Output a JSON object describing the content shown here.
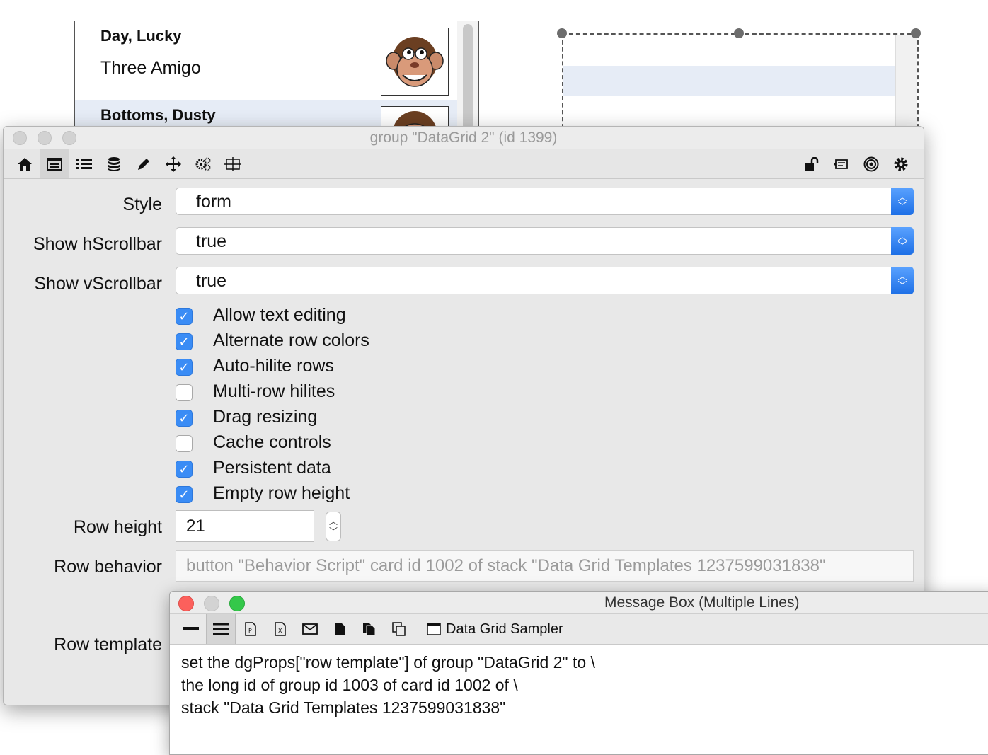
{
  "background_grid": {
    "rows": [
      {
        "name": "Day, Lucky",
        "title": "Three Amigo"
      },
      {
        "name": "Bottoms, Dusty"
      }
    ]
  },
  "inspector": {
    "window_title": "group \"DataGrid 2\" (id 1399)",
    "toolbar_left": [
      "home-icon",
      "table-icon",
      "list-icon",
      "database-icon",
      "pencil-icon",
      "move-icon",
      "gears-icon",
      "resize-icon"
    ],
    "toolbar_right": [
      "lock-icon",
      "message-icon",
      "target-icon",
      "gear-icon"
    ],
    "style": {
      "label": "Style",
      "value": "form"
    },
    "hscroll": {
      "label": "Show hScrollbar",
      "value": "true"
    },
    "vscroll": {
      "label": "Show vScrollbar",
      "value": "true"
    },
    "checkboxes": [
      {
        "label": "Allow text editing",
        "checked": true
      },
      {
        "label": "Alternate row colors",
        "checked": true
      },
      {
        "label": "Auto-hilite rows",
        "checked": true
      },
      {
        "label": "Multi-row hilites",
        "checked": false
      },
      {
        "label": "Drag resizing",
        "checked": true
      },
      {
        "label": "Cache controls",
        "checked": false
      },
      {
        "label": "Persistent data",
        "checked": true
      },
      {
        "label": "Empty row height",
        "checked": true
      }
    ],
    "row_height": {
      "label": "Row height",
      "value": "21"
    },
    "row_behavior": {
      "label": "Row behavior",
      "value": "button \"Behavior Script\" card  id 1002 of stack \"Data Grid Templates 1237599031838\""
    },
    "row_template": {
      "label": "Row template"
    }
  },
  "message_box": {
    "window_title": "Message Box (Multiple Lines)",
    "stack_name": "Data Grid Sampler",
    "script_text": "set the dgProps[\"row template\"] of group \"DataGrid 2\" to \\\nthe long id of group id 1003 of card id 1002 of \\\nstack \"Data Grid Templates 1237599031838\""
  }
}
